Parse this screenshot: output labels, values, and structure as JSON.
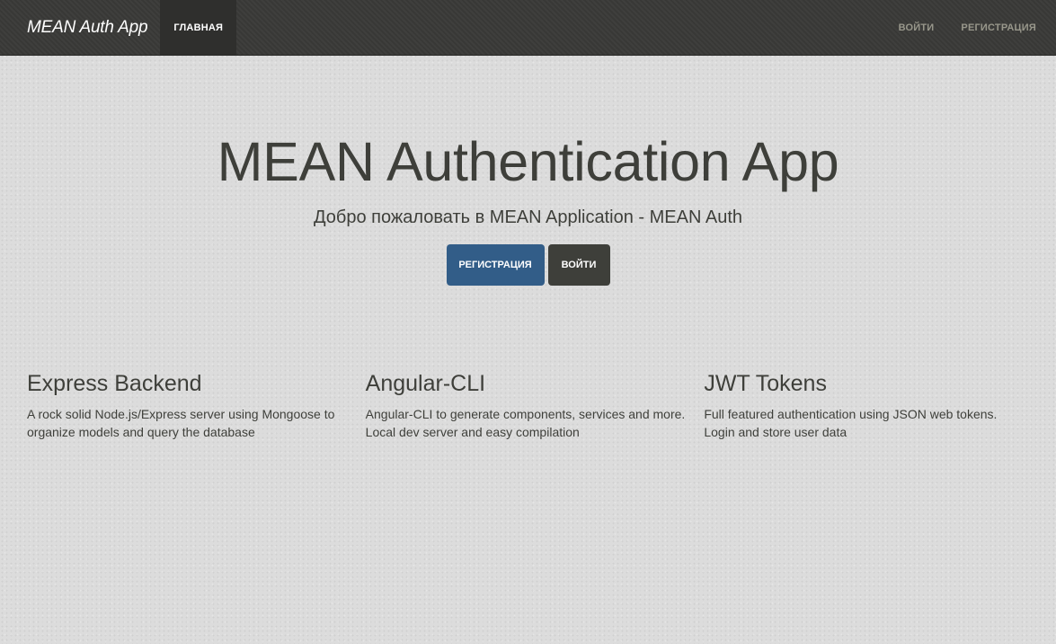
{
  "navbar": {
    "brand": "MEAN Auth App",
    "left_items": [
      {
        "label": "ГЛАВНАЯ",
        "active": true
      }
    ],
    "right_items": [
      {
        "label": "ВОЙТИ"
      },
      {
        "label": "РЕГИСТРАЦИЯ"
      }
    ]
  },
  "hero": {
    "title": "MEAN Authentication App",
    "lead": "Добро пожаловать в MEAN Application - MEAN Auth",
    "register_button": "РЕГИСТРАЦИЯ",
    "login_button": "ВОЙТИ"
  },
  "features": [
    {
      "title": "Express Backend",
      "text": "A rock solid Node.js/Express server using Mongoose to organize models and query the database"
    },
    {
      "title": "Angular-CLI",
      "text": "Angular-CLI to generate components, services and more. Local dev server and easy compilation"
    },
    {
      "title": "JWT Tokens",
      "text": "Full featured authentication using JSON web tokens. Login and store user data"
    }
  ],
  "colors": {
    "navbar_bg": "#3a3a38",
    "active_nav_bg": "#2f2f2d",
    "nav_text": "#98978b",
    "primary": "#325d88",
    "dark": "#3e3f3a",
    "page_bg": "#dcdcdc"
  }
}
